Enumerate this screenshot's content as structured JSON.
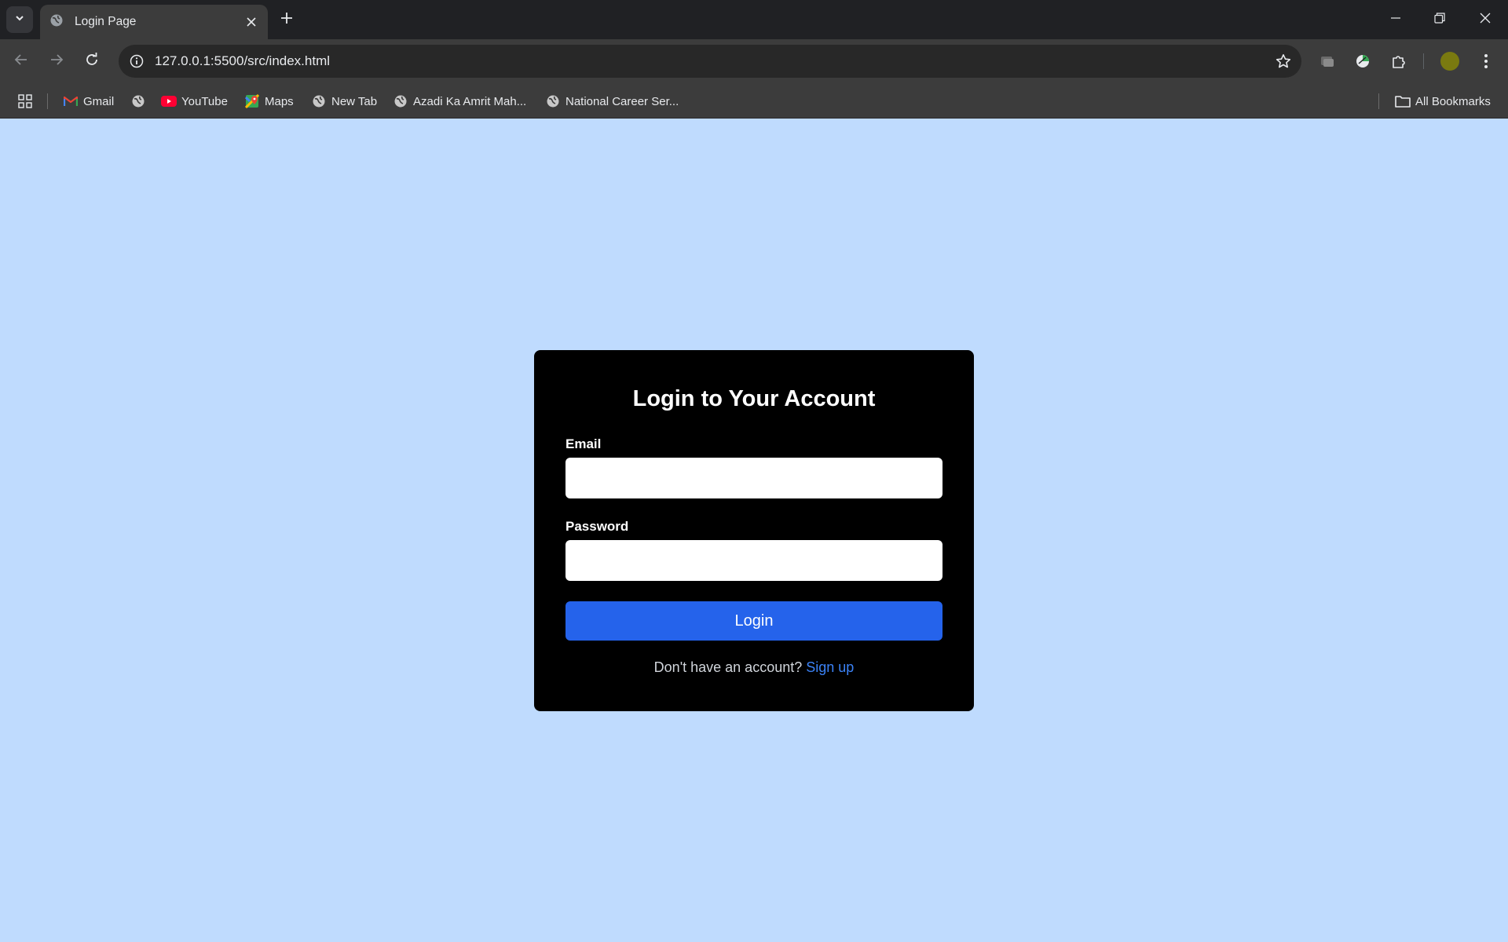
{
  "browser": {
    "tab": {
      "title": "Login Page"
    },
    "address_bar": {
      "url": "127.0.0.1:5500/src/index.html"
    },
    "bookmarks": [
      {
        "label": "Gmail",
        "icon": "gmail-icon"
      },
      {
        "label": "",
        "icon": "globe-icon"
      },
      {
        "label": "YouTube",
        "icon": "youtube-icon"
      },
      {
        "label": "Maps",
        "icon": "maps-icon"
      },
      {
        "label": "New Tab",
        "icon": "globe-icon"
      },
      {
        "label": "Azadi Ka Amrit Mah...",
        "icon": "globe-icon"
      },
      {
        "label": "National Career Ser...",
        "icon": "globe-icon"
      }
    ],
    "all_bookmarks_label": "All Bookmarks",
    "colors": {
      "chrome_dark": "#202124",
      "toolbar": "#3c3c3c",
      "avatar": "#7a7a10"
    }
  },
  "login": {
    "title": "Login to Your Account",
    "email_label": "Email",
    "email_value": "",
    "password_label": "Password",
    "password_value": "",
    "button_label": "Login",
    "signup_prompt": "Don't have an account?",
    "signup_link": "Sign up"
  },
  "colors": {
    "page_background": "#bfdbfe",
    "card_background": "#000000",
    "button_background": "#2563eb",
    "link": "#3b82f6"
  }
}
